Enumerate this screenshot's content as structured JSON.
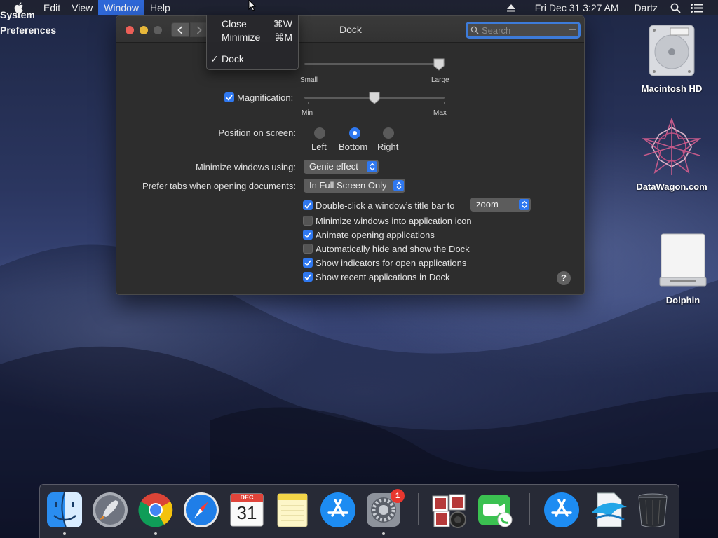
{
  "menubar": {
    "app_name": "System Preferences",
    "menus": [
      "Edit",
      "View",
      "Window",
      "Help"
    ],
    "clock": "Fri Dec 31  3:27 AM",
    "user": "Dartz"
  },
  "window_menu": {
    "items": [
      {
        "label": "Close",
        "shortcut": "⌘W"
      },
      {
        "label": "Minimize",
        "shortcut": "⌘M"
      },
      {
        "label": "Dock",
        "checked": true
      }
    ]
  },
  "prefs_window": {
    "title": "Dock",
    "search_placeholder": "Search",
    "size_min_label": "Small",
    "size_max_label": "Large",
    "size_value": 1.0,
    "magnification": {
      "label": "Magnification:",
      "checked": true,
      "min_label": "Min",
      "max_label": "Max",
      "value": 0.5
    },
    "position": {
      "label": "Position on screen:",
      "options": [
        "Left",
        "Bottom",
        "Right"
      ],
      "selected": "Bottom"
    },
    "minimize_using": {
      "label": "Minimize windows using:",
      "value": "Genie effect"
    },
    "prefer_tabs": {
      "label": "Prefer tabs when opening documents:",
      "value": "In Full Screen Only"
    },
    "double_click": {
      "label": "Double-click a window’s title bar to",
      "checked": true,
      "value": "zoom"
    },
    "options": [
      {
        "label": "Minimize windows into application icon",
        "checked": false
      },
      {
        "label": "Animate opening applications",
        "checked": true
      },
      {
        "label": "Automatically hide and show the Dock",
        "checked": false
      },
      {
        "label": "Show indicators for open applications",
        "checked": true
      },
      {
        "label": "Show recent applications in Dock",
        "checked": true
      }
    ],
    "help_label": "?"
  },
  "desktop_icons": [
    {
      "label": "Macintosh HD"
    },
    {
      "label": "DataWagon.com"
    },
    {
      "label": "Dolphin"
    }
  ],
  "dock": {
    "calendar_month": "DEC",
    "calendar_day": "31",
    "sysprefs_badge": "1"
  }
}
